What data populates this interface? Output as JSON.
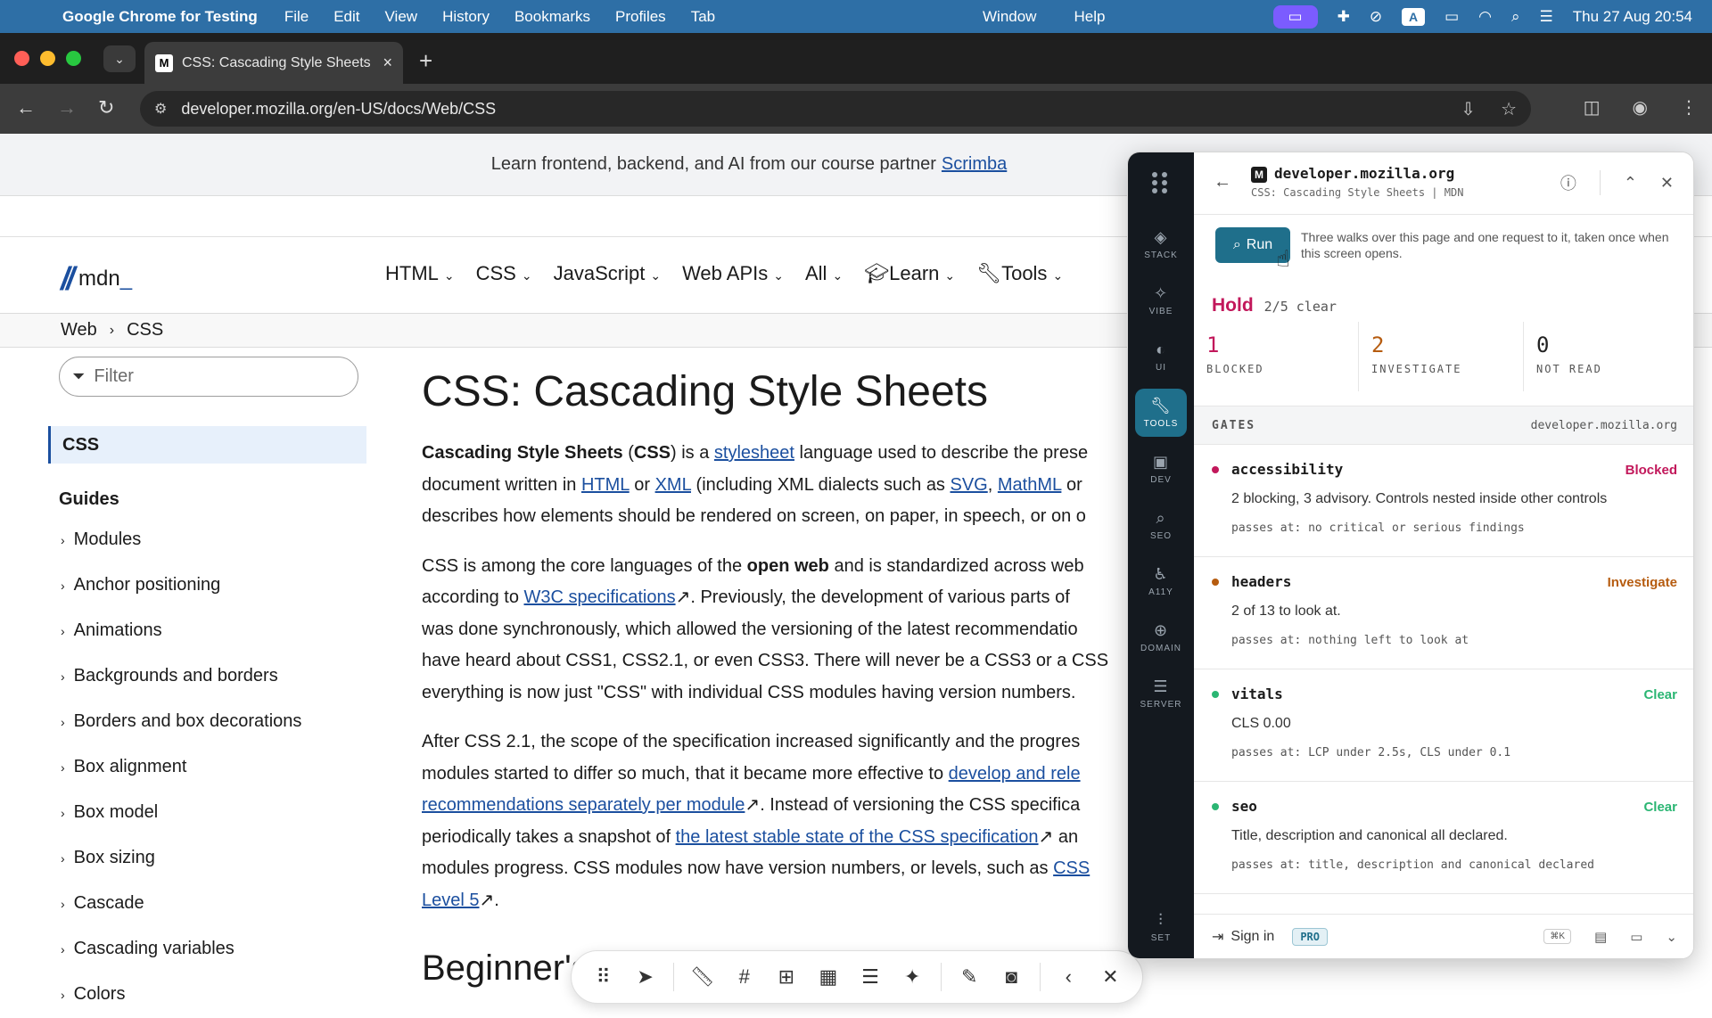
{
  "menubar": {
    "app_name": "Google Chrome for Testing",
    "items_left": [
      "File",
      "Edit",
      "View",
      "History",
      "Bookmarks",
      "Profiles",
      "Tab"
    ],
    "items_right": [
      "Window",
      "Help"
    ],
    "datetime": "Thu 27 Aug  20:54",
    "badge_a": "A"
  },
  "browser": {
    "tab_title": "CSS: Cascading Style Sheets",
    "tab_favicon": "M",
    "url": "developer.mozilla.org/en-US/docs/Web/CSS"
  },
  "page": {
    "banner_text": "Learn frontend, backend, and AI from our course partner",
    "banner_link": "Scrimba",
    "logo_text": "mdn",
    "logo_suffix": "_",
    "nav": [
      {
        "label": "HTML"
      },
      {
        "label": "CSS"
      },
      {
        "label": "JavaScript"
      },
      {
        "label": "Web APIs"
      },
      {
        "label": "All"
      },
      {
        "label": "Learn",
        "icon": "graduation-cap-icon"
      },
      {
        "label": "Tools",
        "icon": "wrench-icon"
      }
    ],
    "breadcrumb": [
      "Web",
      "CSS"
    ],
    "filter_placeholder": "Filter",
    "sidebar_current": "CSS",
    "sidebar_heading": "Guides",
    "sidebar_items": [
      "Modules",
      "Anchor positioning",
      "Animations",
      "Backgrounds and borders",
      "Borders and box decorations",
      "Box alignment",
      "Box model",
      "Box sizing",
      "Cascade",
      "Cascading variables",
      "Colors"
    ],
    "title": "CSS: Cascading Style Sheets",
    "p1": {
      "l1a": "Cascading Style Sheets",
      "l1b": " (",
      "l1c": "CSS",
      "l1d": ") is a ",
      "l1link": "stylesheet",
      "l1e": " language used to describe the prese",
      "l2a": "document written in ",
      "l2link1": "HTML",
      "l2b": " or ",
      "l2link2": "XML",
      "l2c": " (including XML dialects such as ",
      "l2link3": "SVG",
      "l2d": ", ",
      "l2link4": "MathML",
      "l2e": " or",
      "l3": "describes how elements should be rendered on screen, on paper, in speech, or on o"
    },
    "p2": {
      "l1a": "CSS is among the core languages of the ",
      "l1b": "open web",
      "l1c": " and is standardized across web",
      "l2a": "according to ",
      "l2link": "W3C specifications",
      "l2b": ". Previously, the development of various parts of",
      "l3": "was done synchronously, which allowed the versioning of the latest recommendatio",
      "l4": "have heard about CSS1, CSS2.1, or even CSS3. There will never be a CSS3 or a CSS",
      "l5": "everything is now just \"CSS\" with individual CSS modules having version numbers."
    },
    "p3": {
      "l1": "After CSS 2.1, the scope of the specification increased significantly and the progres",
      "l2a": "modules started to differ so much, that it became more effective to ",
      "l2link": "develop and rele",
      "l3link": "recommendations separately per module",
      "l3b": ". Instead of versioning the CSS specifica",
      "l4a": "periodically takes a snapshot of ",
      "l4link": "the latest stable state of the CSS specification",
      "l4b": " an",
      "l5a": "modules progress. CSS modules now have version numbers, or levels, such as ",
      "l5link": "CSS",
      "l6link": "Level 5",
      "l6b": "."
    },
    "h2": "Beginner's"
  },
  "float_toolbar": {
    "icons": [
      "drag-handle-icon",
      "pointer-icon",
      "ruler-icon",
      "grid-frame-icon",
      "layout-icon",
      "table-icon",
      "list-icon",
      "sparkle-icon",
      "eyedropper-icon",
      "camera-icon",
      "chevron-left-icon",
      "close-icon"
    ]
  },
  "extension": {
    "rail": [
      {
        "label": "STACK",
        "icon": "layers-icon"
      },
      {
        "label": "VIBE",
        "icon": "sparkle-icon"
      },
      {
        "label": "UI",
        "icon": "palette-icon"
      },
      {
        "label": "TOOLS",
        "icon": "wrench-icon",
        "active": true
      },
      {
        "label": "DEV",
        "icon": "terminal-icon"
      },
      {
        "label": "SEO",
        "icon": "search-icon"
      },
      {
        "label": "A11Y",
        "icon": "accessibility-icon"
      },
      {
        "label": "DOMAIN",
        "icon": "globe-icon"
      },
      {
        "label": "SERVER",
        "icon": "server-icon"
      }
    ],
    "rail_bottom": {
      "label": "SET",
      "icon": "sliders-icon"
    },
    "header": {
      "favicon": "M",
      "domain": "developer.mozilla.org",
      "subtitle": "CSS: Cascading Style Sheets | MDN"
    },
    "run_label": "Run",
    "run_desc": "Three walks over this page and one request to it, taken once when this screen opens.",
    "verdict": "Hold",
    "verdict_detail": "2/5 clear",
    "counts": [
      {
        "num": "1",
        "label": "BLOCKED",
        "color": "#c2185b"
      },
      {
        "num": "2",
        "label": "INVESTIGATE",
        "color": "#b65c10"
      },
      {
        "num": "0",
        "label": "NOT READ",
        "color": "#222222"
      }
    ],
    "gates_label": "GATES",
    "gates_domain": "developer.mozilla.org",
    "gates": [
      {
        "name": "accessibility",
        "status": "Blocked",
        "color": "#c2185b",
        "desc": "2 blocking, 3 advisory. Controls nested inside other controls",
        "pass": "passes at: no critical or serious findings"
      },
      {
        "name": "headers",
        "status": "Investigate",
        "color": "#b65c10",
        "desc": "2 of 13 to look at.",
        "pass": "passes at: nothing left to look at"
      },
      {
        "name": "vitals",
        "status": "Clear",
        "color": "#2bb673",
        "desc": "CLS 0.00",
        "pass": "passes at: LCP under 2.5s, CLS under 0.1"
      },
      {
        "name": "seo",
        "status": "Clear",
        "color": "#2bb673",
        "desc": "Title, description and canonical all declared.",
        "pass": "passes at: title, description and canonical declared"
      }
    ],
    "footer": {
      "signin": "Sign in",
      "pro": "PRO",
      "kbd": "⌘K"
    }
  }
}
